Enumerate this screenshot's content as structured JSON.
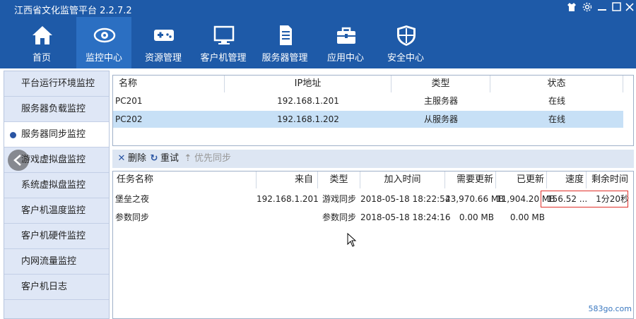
{
  "window": {
    "title": "江西省文化监管平台 2.2.7.2"
  },
  "toolbar": {
    "items": [
      {
        "label": "首页",
        "icon": "home-icon"
      },
      {
        "label": "监控中心",
        "icon": "eye-icon"
      },
      {
        "label": "资源管理",
        "icon": "gamepad-icon"
      },
      {
        "label": "客户机管理",
        "icon": "monitor-icon"
      },
      {
        "label": "服务器管理",
        "icon": "server-icon"
      },
      {
        "label": "应用中心",
        "icon": "toolbox-icon"
      },
      {
        "label": "安全中心",
        "icon": "shield-icon"
      }
    ],
    "active": "监控中心"
  },
  "sidebar": {
    "items": [
      {
        "label": "平台运行环境监控"
      },
      {
        "label": "服务器负载监控"
      },
      {
        "label": "服务器同步监控"
      },
      {
        "label": "游戏虚拟盘监控"
      },
      {
        "label": "系统虚拟盘监控"
      },
      {
        "label": "客户机温度监控"
      },
      {
        "label": "客户机硬件监控"
      },
      {
        "label": "内网流量监控"
      },
      {
        "label": "客户机日志"
      }
    ],
    "active": "服务器同步监控"
  },
  "servers": {
    "columns": [
      "名称",
      "IP地址",
      "类型",
      "状态"
    ],
    "rows": [
      {
        "name": "PC201",
        "ip": "192.168.1.201",
        "type": "主服务器",
        "status": "在线"
      },
      {
        "name": "PC202",
        "ip": "192.168.1.202",
        "type": "从服务器",
        "status": "在线"
      }
    ]
  },
  "actions": {
    "delete": "删除",
    "retry": "重试",
    "priority": "优先同步"
  },
  "tasks": {
    "columns": [
      "任务名称",
      "来自",
      "类型",
      "加入时间",
      "需要更新",
      "已更新",
      "速度",
      "剩余时间"
    ],
    "rows": [
      {
        "name": "堡垒之夜",
        "from": "192.168.1.201",
        "type": "游戏同步",
        "time": "2018-05-18 18:22:54",
        "need": "23,970.66 MB",
        "done": "11,904.20 MB",
        "speed": "156.52 ...",
        "remain": "1分20秒"
      },
      {
        "name": "参数同步",
        "from": "",
        "type": "参数同步",
        "time": "2018-05-18 18:24:16",
        "need": "0.00 MB",
        "done": "0.00 MB",
        "speed": "",
        "remain": ""
      }
    ]
  },
  "watermark": "583go.com",
  "colors": {
    "topbar": "#1e5aa8",
    "active_tab": "#2b6fc2",
    "sidebar": "#dfe7f6",
    "selected_row": "#c7e0f6",
    "highlight": "#e0302a"
  }
}
